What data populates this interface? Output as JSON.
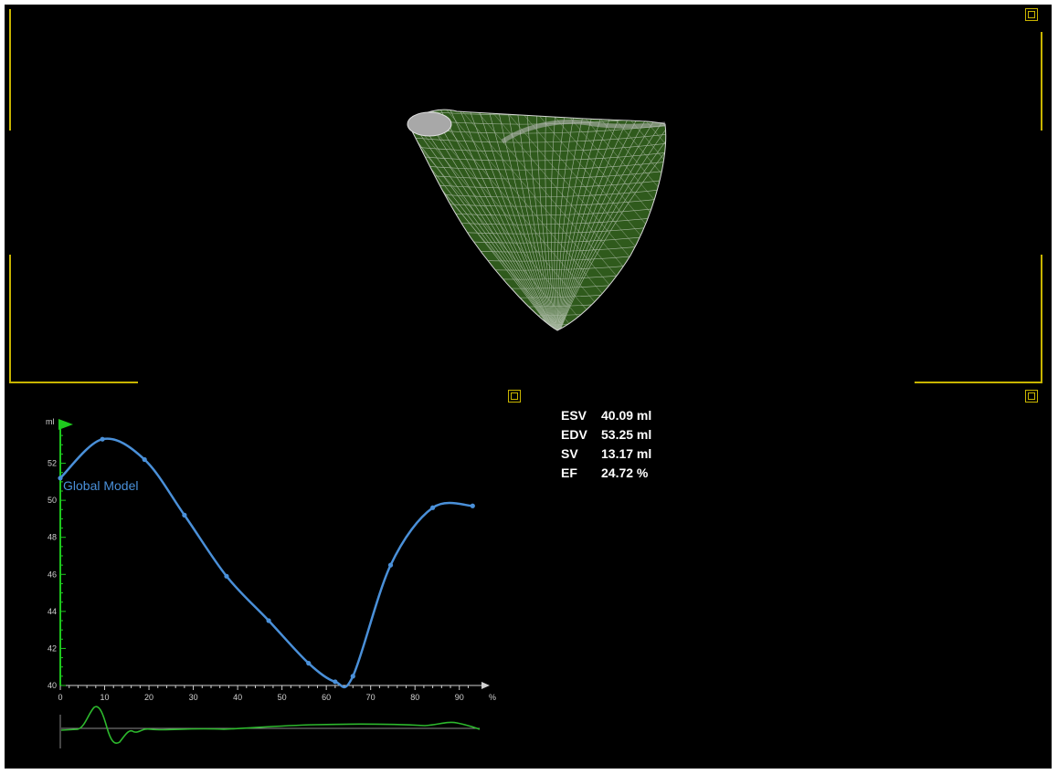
{
  "stats": [
    {
      "label": "ESV",
      "value": "40.09 ml"
    },
    {
      "label": "EDV",
      "value": "53.25 ml"
    },
    {
      "label": "SV",
      "value": "13.17 ml"
    },
    {
      "label": "EF",
      "value": "24.72 %"
    }
  ],
  "colors": {
    "frame": "#c8b400",
    "curve": "#4a90d9",
    "axis": "#1ec81e",
    "ecg": "#2db82d",
    "mesh_fill": "#2f5a1c",
    "mesh_wire": "#d8d8d8"
  },
  "chart_data": {
    "type": "line",
    "xlabel": "%",
    "ylabel": "ml",
    "xlim": [
      0,
      95
    ],
    "ylim": [
      40,
      54
    ],
    "x_ticks": [
      0,
      10,
      20,
      30,
      40,
      50,
      60,
      70,
      80,
      90
    ],
    "y_ticks": [
      40,
      42,
      44,
      46,
      48,
      50,
      52
    ],
    "series": [
      {
        "name": "Global Model",
        "x": [
          0,
          9.5,
          19,
          28,
          37.5,
          47,
          56,
          62,
          66,
          74.5,
          84,
          93
        ],
        "y": [
          51.2,
          53.3,
          52.2,
          49.2,
          45.9,
          43.5,
          41.2,
          40.2,
          40.5,
          46.5,
          49.6,
          49.7
        ]
      }
    ]
  }
}
